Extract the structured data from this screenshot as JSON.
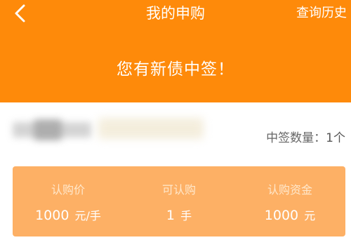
{
  "nav": {
    "title": "我的申购",
    "right_action": "查询历史",
    "back_icon": "chevron-left-icon"
  },
  "banner": {
    "text": "您有新债中签！"
  },
  "bond": {
    "lot_label": "中签数量：",
    "lot_value": "1个"
  },
  "card": {
    "columns": [
      {
        "label": "认购价",
        "value": "1000",
        "unit": "元/手"
      },
      {
        "label": "可认购",
        "value": "1",
        "unit": "手"
      },
      {
        "label": "认购资金",
        "value": "1000",
        "unit": "元"
      }
    ]
  },
  "colors": {
    "header_bg": "#fe8a0a",
    "card_bg": "#fdb065",
    "text_white": "#ffffff",
    "text_gray": "#666666"
  }
}
